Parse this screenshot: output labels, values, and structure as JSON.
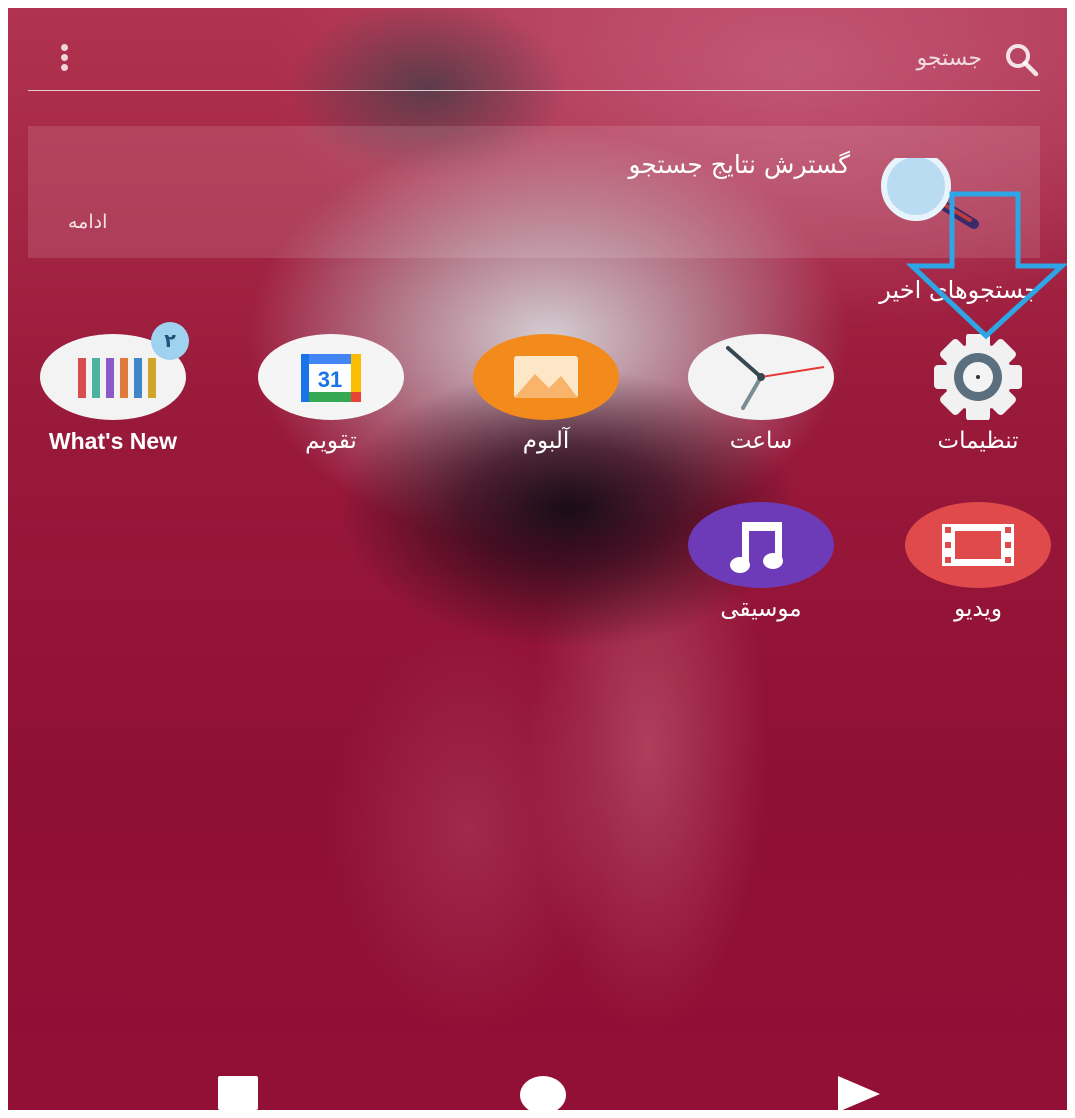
{
  "search": {
    "placeholder": "جستجو",
    "icon": "search-icon",
    "menu_icon": "overflow-menu-icon"
  },
  "expand_card": {
    "title": "گسترش نتایج جستجو",
    "action": "ادامه"
  },
  "recent": {
    "heading": "جستجوهای اخیر"
  },
  "apps": [
    {
      "label": "تنظیمات",
      "icon": "settings-gear-icon"
    },
    {
      "label": "ساعت",
      "icon": "clock-icon"
    },
    {
      "label": "آلبوم",
      "icon": "album-icon"
    },
    {
      "label": "تقویم",
      "icon": "calendar-icon",
      "icon_text": "31"
    },
    {
      "label": "What's New",
      "icon": "whats-new-icon",
      "badge": "۲"
    },
    {
      "label": "ویدیو",
      "icon": "video-icon"
    },
    {
      "label": "موسیقی",
      "icon": "music-icon"
    }
  ],
  "nav": {
    "recent_icon": "recent-apps-square-icon",
    "home_icon": "home-circle-icon",
    "back_icon": "back-triangle-icon"
  },
  "colors": {
    "wallpaper": "#9a1a3b",
    "annotation_arrow": "#2ea6e6",
    "badge": "#9ed2ef",
    "album": "#f28a1c",
    "video": "#e04a4a",
    "music": "#6e3bb8"
  }
}
